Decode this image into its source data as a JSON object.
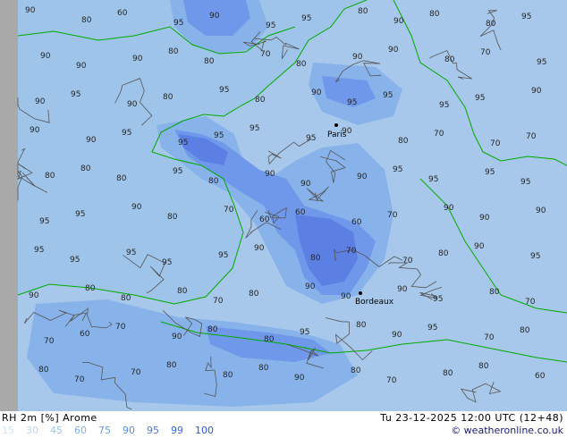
{
  "map": {
    "colors": {
      "sea": "#9ec4ea",
      "land_low": "#a7c8ea",
      "rh_90": "#88b3ea",
      "rh_95": "#6f98ea",
      "rh_99": "#5b7fe3",
      "outside": "#a9a9a9",
      "coast": "#00aa00",
      "contour": "#555555"
    },
    "cities": [
      {
        "name": "Paris"
      },
      {
        "name": "Bordeaux"
      }
    ],
    "contour_labels": [
      "90",
      "80",
      "60",
      "95",
      "90",
      "95",
      "95",
      "80",
      "90",
      "80",
      "80",
      "95",
      "90",
      "90",
      "90",
      "80",
      "80",
      "70",
      "80",
      "90",
      "90",
      "80",
      "70",
      "95",
      "90",
      "95",
      "90",
      "80",
      "95",
      "80",
      "90",
      "95",
      "95",
      "95",
      "95",
      "90",
      "90",
      "90",
      "95",
      "95",
      "95",
      "95",
      "95",
      "90",
      "80",
      "70",
      "70",
      "70",
      "80",
      "80",
      "80",
      "95",
      "80",
      "90",
      "90",
      "90",
      "95",
      "95",
      "95",
      "95",
      "95",
      "95",
      "90",
      "80",
      "70",
      "60",
      "60",
      "60",
      "70",
      "90",
      "90",
      "90",
      "95",
      "95",
      "95",
      "95",
      "95",
      "90",
      "80",
      "70",
      "70",
      "80",
      "90",
      "95",
      "90",
      "80",
      "80",
      "80",
      "70",
      "80",
      "90",
      "90",
      "90",
      "95",
      "80",
      "70",
      "70",
      "60",
      "70",
      "90",
      "80",
      "80",
      "95",
      "80",
      "90",
      "95",
      "70",
      "80",
      "80",
      "70",
      "70",
      "80",
      "80",
      "80",
      "90",
      "80",
      "70",
      "80",
      "80",
      "60"
    ]
  },
  "footer": {
    "product": "RH 2m [%] Arome",
    "datetime": "Tu 23-12-2025 12:00 UTC (12+48)",
    "credit": "© weatheronline.co.uk",
    "legend": [
      {
        "label": "15",
        "color": "#d0e4f7"
      },
      {
        "label": "30",
        "color": "#b8d6f2"
      },
      {
        "label": "45",
        "color": "#a0c6ee"
      },
      {
        "label": "60",
        "color": "#7fb1ea"
      },
      {
        "label": "75",
        "color": "#6a9ee6"
      },
      {
        "label": "90",
        "color": "#5a8de4"
      },
      {
        "label": "95",
        "color": "#4a79e0"
      },
      {
        "label": "99",
        "color": "#3a67dc"
      },
      {
        "label": "100",
        "color": "#2f55d6"
      }
    ]
  }
}
